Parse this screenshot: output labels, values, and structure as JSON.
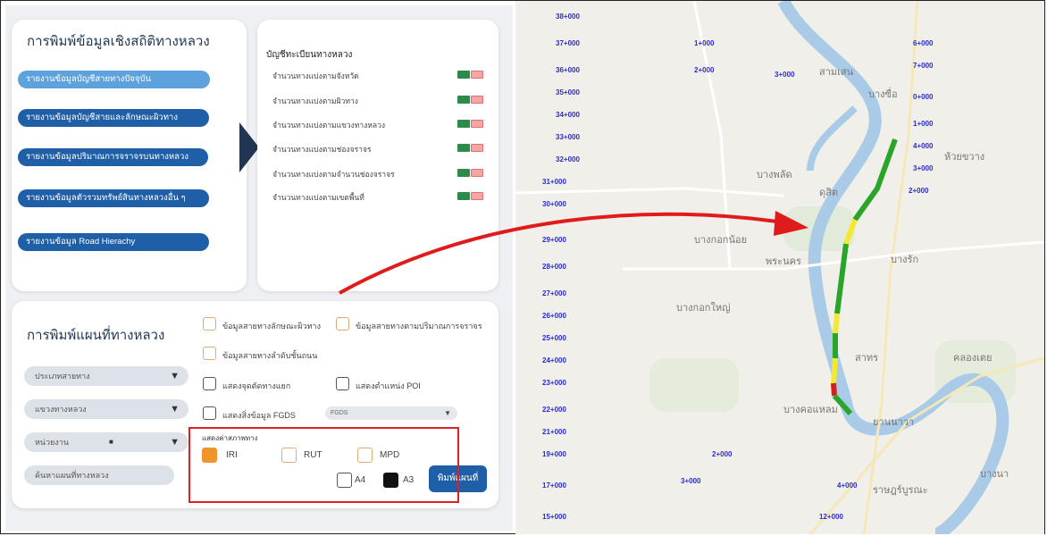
{
  "stats_card": {
    "title": "การพิมพ์ข้อมูลเชิงสถิติทางหลวง",
    "buttons": [
      {
        "label": "รายงานข้อมูลบัญชีสายทางปัจจุบัน"
      },
      {
        "label": "รายงานข้อมูลบัญชีสายและลักษณะผิวทาง"
      },
      {
        "label": "รายงานข้อมูลปริมาณการจราจรบนทางหลวง"
      },
      {
        "label": "รายงานข้อมูลตัวรวมทรัพย์สินทางหลวงอื่น ๆ"
      },
      {
        "label": "รายงานข้อมูล Road Hierachy"
      }
    ]
  },
  "register_card": {
    "title": "บัญชีทะเบียนทางหลวง",
    "rows": [
      {
        "label": "จำนวนทางแบ่งตามจังหวัด"
      },
      {
        "label": "จำนวนทางแบ่งตามผิวทาง"
      },
      {
        "label": "จำนวนทางแบ่งตามแขวงทางหลวง"
      },
      {
        "label": "จำนวนทางแบ่งตามช่องจราจร"
      },
      {
        "label": "จำนวนทางแบ่งตามจำนวนช่องจราจร"
      },
      {
        "label": "จำนวนทางแบ่งตามเขตพื้นที่"
      }
    ]
  },
  "map_print_card": {
    "title": "การพิมพ์แผนที่ทางหลวง",
    "dropdowns": [
      {
        "value": "ประเภทสายทาง"
      },
      {
        "value": "แขวงทางหลวง"
      },
      {
        "value": "หน่วยงาน"
      },
      {
        "value": "ค้นหาแผนที่ทางหลวง"
      }
    ],
    "checkboxes": {
      "c1": "ข้อมูลสายทางลักษณะผิวทาง",
      "c2": "ข้อมูลสายทางตามปริมาณการจราจร",
      "c3": "ข้อมูลสายทางลำดับชั้นถนน",
      "c4": "แสดงจุดตัดทางแยก",
      "c5": "แสดงตำแหน่ง POI",
      "c6": "แสดงสิ่งข้อมูล FGDS",
      "fgds_placeholder": "FGDS"
    },
    "road_condition_title": "แสดงค่าสภาพทาง",
    "iri_label": "IRI",
    "rut_label": "RUT",
    "mpd_label": "MPD",
    "a4_label": "A4",
    "a3_label": "A3",
    "print_label": "พิมพ์แผนที่"
  },
  "map": {
    "place_labels": [
      "บางซื่อ",
      "ดุสิต",
      "บางพลัด",
      "สามเสน",
      "บางกอกน้อย",
      "พระนคร",
      "บางกอกใหญ่",
      "สาทร",
      "บางคอแหลม",
      "ราษฎร์บูรณะ",
      "ห้วยขวาง",
      "บางรัก",
      "คลองเตย",
      "ยานนาวา",
      "บางนา"
    ],
    "segment_colors": [
      "#2aa52a",
      "#f3e832",
      "#d91e1e"
    ]
  }
}
